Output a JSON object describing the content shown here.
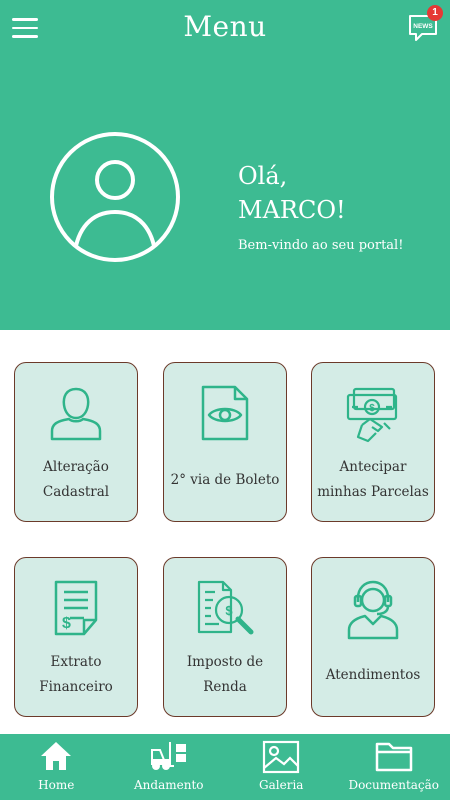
{
  "app": {
    "title": "Menu",
    "news_icon_text": "NEWS",
    "news_badge": "1"
  },
  "profile": {
    "greeting": "Olá,",
    "name": "MARCO!",
    "welcome": "Bem-vindo ao seu portal!"
  },
  "cards": [
    {
      "label": "Alteração\nCadastral",
      "icon": "user-icon"
    },
    {
      "label": "2° via de Boleto",
      "icon": "document-eye-icon"
    },
    {
      "label": "Antecipar\nminhas Parcelas",
      "icon": "money-hand-icon"
    },
    {
      "label": "Extrato\nFinanceiro",
      "icon": "statement-icon"
    },
    {
      "label": "Imposto de\nRenda",
      "icon": "tax-search-icon"
    },
    {
      "label": "Atendimentos",
      "icon": "headset-icon"
    }
  ],
  "nav": [
    {
      "label": "Home",
      "icon": "home-icon"
    },
    {
      "label": "Andamento",
      "icon": "forklift-icon"
    },
    {
      "label": "Galeria",
      "icon": "image-icon"
    },
    {
      "label": "Documentação",
      "icon": "folder-icon"
    }
  ],
  "colors": {
    "primary": "#3dbb92",
    "card_bg": "#d4ece6",
    "card_border": "#6b3a2a",
    "icon": "#2fb48a",
    "badge": "#e53935"
  }
}
